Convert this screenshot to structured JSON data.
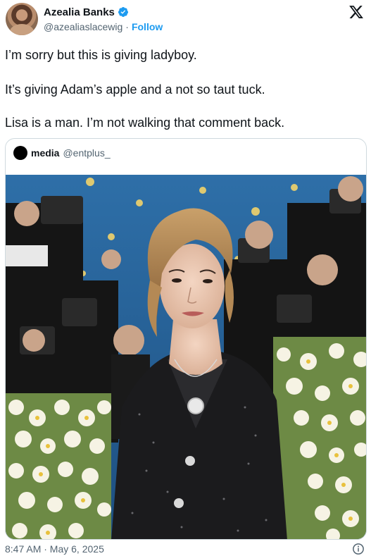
{
  "author": {
    "name": "Azealia Banks",
    "handle": "@azealiaslacewig",
    "separator": "·",
    "follow_label": "Follow",
    "verified_color": "#1d9bf0"
  },
  "tweet": {
    "lines": [
      "I’m sorry but this is giving ladyboy.",
      "It’s giving Adam’s apple and a not so taut tuck.",
      "Lisa is a man. I’m not walking that comment back."
    ]
  },
  "quoted": {
    "name": "media",
    "handle": "@entplus_"
  },
  "footer": {
    "timestamp": "8:47 AM · May 6, 2025"
  },
  "icons": {
    "logo": "x-logo-icon",
    "verified": "verified-badge-icon",
    "info": "info-icon"
  },
  "colors": {
    "accent": "#1d9bf0",
    "text": "#0f1419",
    "secondary": "#536471",
    "border": "#cfd9de"
  }
}
